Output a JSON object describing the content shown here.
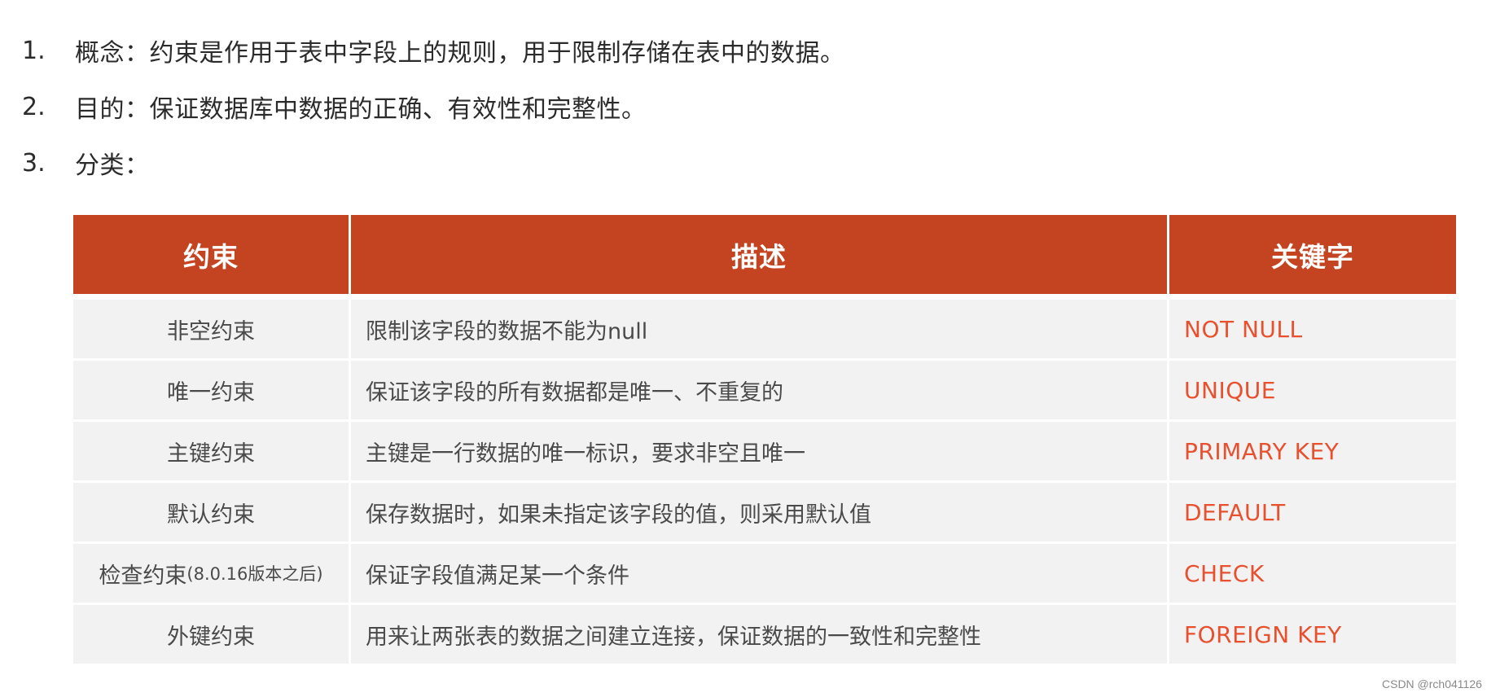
{
  "list": [
    {
      "number": "1.",
      "text": "概念：约束是作用于表中字段上的规则，用于限制存储在表中的数据。"
    },
    {
      "number": "2.",
      "text": "目的：保证数据库中数据的正确、有效性和完整性。"
    },
    {
      "number": "3.",
      "text": "分类："
    }
  ],
  "table": {
    "headers": [
      "约束",
      "描述",
      "关键字"
    ],
    "rows": [
      {
        "constraint": "非空约束",
        "constraint_note": "",
        "description": "限制该字段的数据不能为null",
        "keyword": "NOT  NULL"
      },
      {
        "constraint": "唯一约束",
        "constraint_note": "",
        "description": "保证该字段的所有数据都是唯一、不重复的",
        "keyword": "UNIQUE"
      },
      {
        "constraint": "主键约束",
        "constraint_note": "",
        "description": "主键是一行数据的唯一标识，要求非空且唯一",
        "keyword": "PRIMARY  KEY"
      },
      {
        "constraint": "默认约束",
        "constraint_note": "",
        "description": "保存数据时，如果未指定该字段的值，则采用默认值",
        "keyword": "DEFAULT"
      },
      {
        "constraint": "检查约束",
        "constraint_note": "(8.0.16版本之后)",
        "description": "保证字段值满足某一个条件",
        "keyword": "CHECK"
      },
      {
        "constraint": "外键约束",
        "constraint_note": "",
        "description": "用来让两张表的数据之间建立连接，保证数据的一致性和完整性",
        "keyword": "FOREIGN  KEY"
      }
    ]
  },
  "colors": {
    "header_bg": "#C44422",
    "header_text": "#FFFFFF",
    "cell_bg": "#F2F2F2",
    "keyword_text": "#E8502E",
    "body_text": "#4A4A4A"
  },
  "watermark": "CSDN @rch041126"
}
